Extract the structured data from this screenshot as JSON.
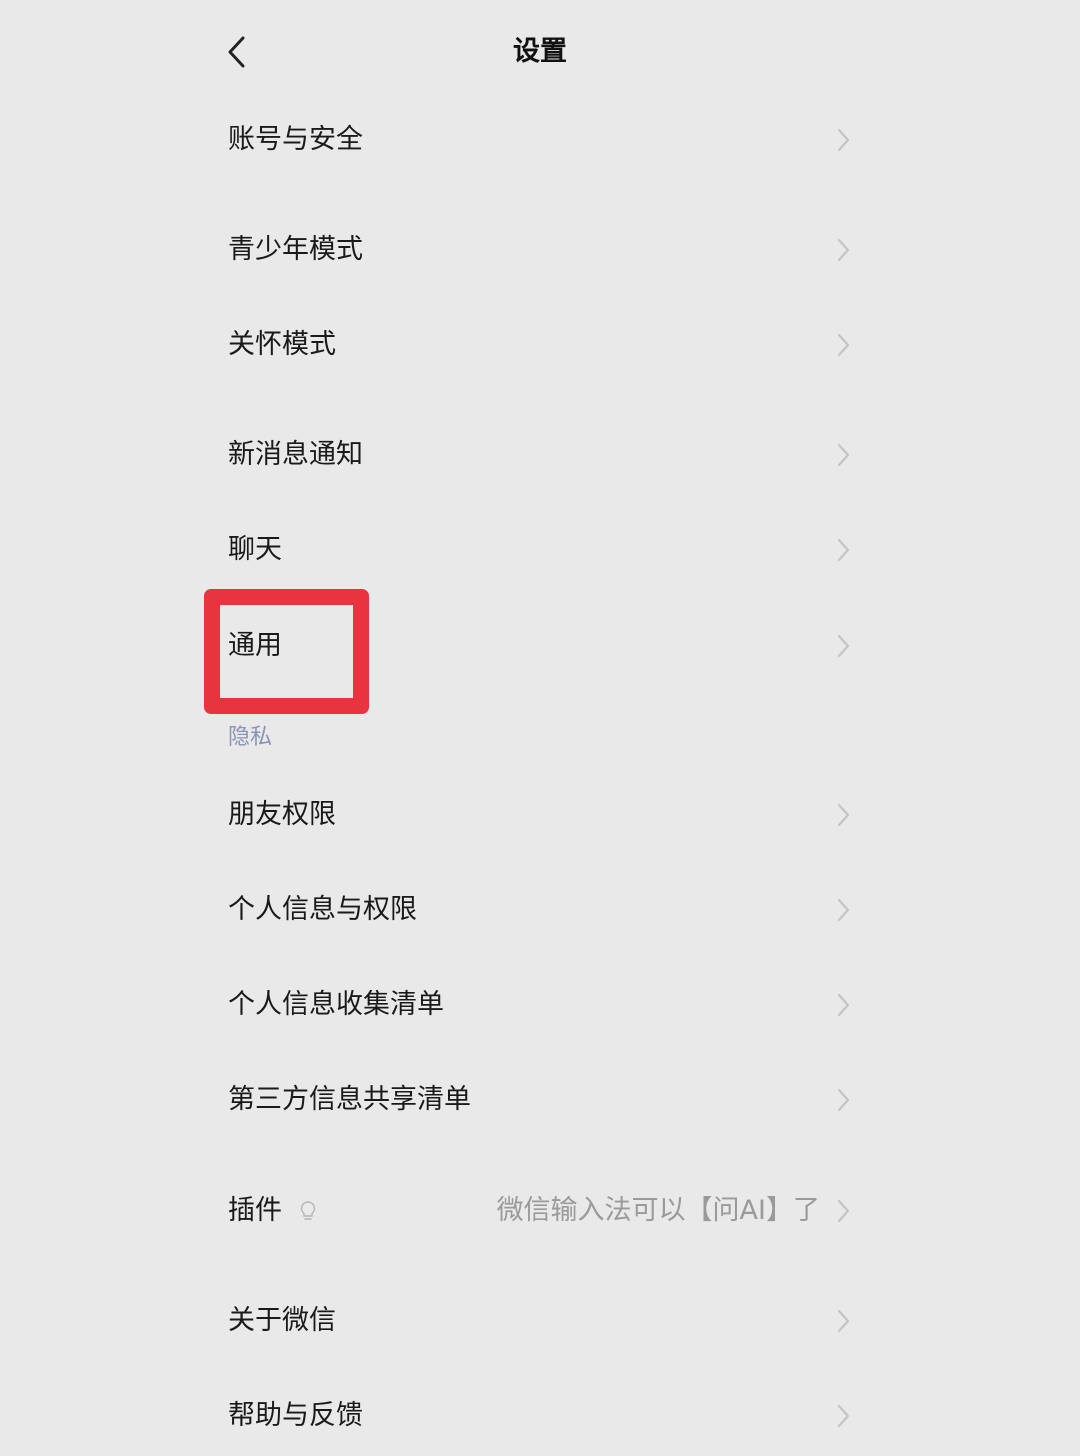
{
  "header": {
    "title": "设置"
  },
  "items": [
    {
      "label": "账号与安全"
    },
    {
      "label": "青少年模式"
    },
    {
      "label": "关怀模式"
    },
    {
      "label": "新消息通知"
    },
    {
      "label": "聊天"
    },
    {
      "label": "通用"
    }
  ],
  "privacy_section": {
    "label": "隐私",
    "items": [
      {
        "label": "朋友权限"
      },
      {
        "label": "个人信息与权限"
      },
      {
        "label": "个人信息收集清单"
      },
      {
        "label": "第三方信息共享清单"
      }
    ]
  },
  "plugin": {
    "label": "插件",
    "value": "微信输入法可以【问AI】了"
  },
  "bottom_items": [
    {
      "label": "关于微信"
    },
    {
      "label": "帮助与反馈"
    }
  ],
  "colors": {
    "background": "#e9e9e9",
    "highlight": "#e8343f",
    "section_label": "#8a93b8",
    "chevron": "#c4c4c4"
  },
  "icons": {
    "back": "chevron-left-icon",
    "row_arrow": "chevron-right-icon",
    "plugin": "lightbulb-icon"
  }
}
